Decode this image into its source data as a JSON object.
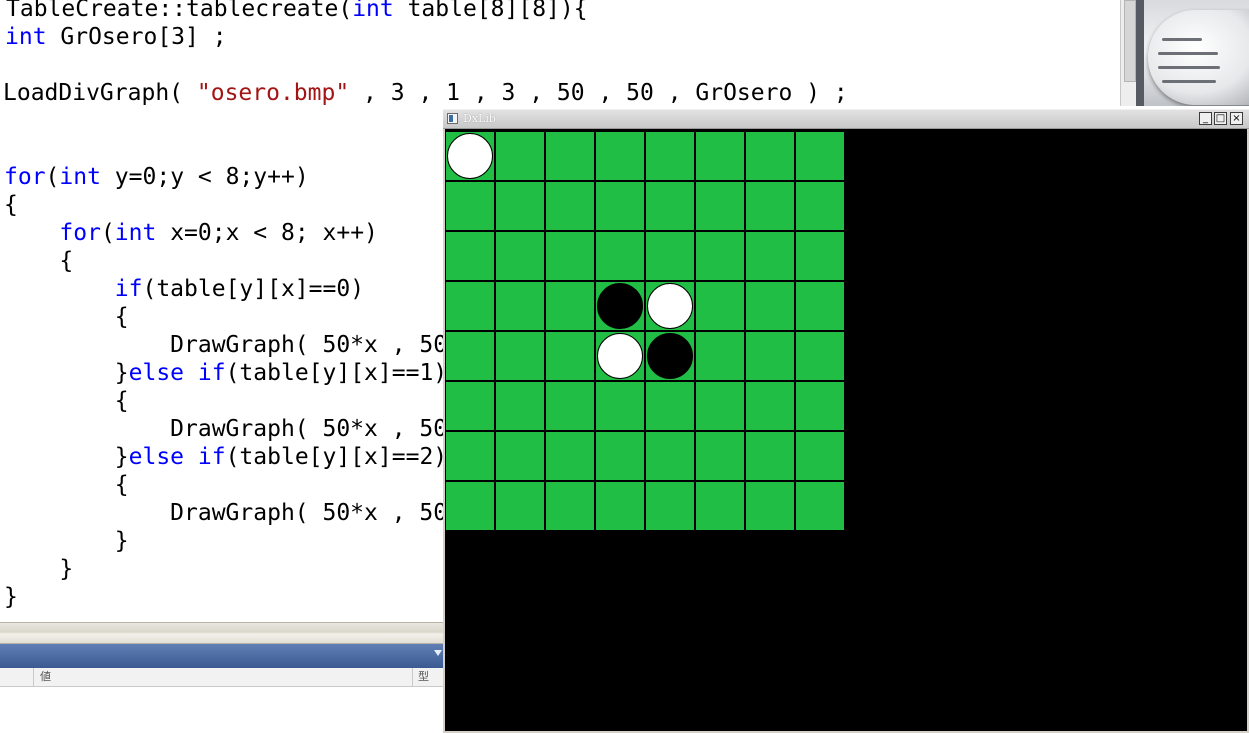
{
  "editor": {
    "lines": [
      [
        {
          "t": "TableCreate::tablecreate("
        },
        {
          "t": "int",
          "c": "kw"
        },
        {
          "t": " table[8][8]){"
        }
      ],
      [
        {
          "t": "int",
          "c": "kw"
        },
        {
          "t": " GrOsero[3] ;"
        }
      ],
      [],
      [
        {
          "t": "LoadDivGraph( "
        },
        {
          "t": "\"osero.bmp\"",
          "c": "str"
        },
        {
          "t": " , 3 , 1 , 3 , 50 , 50 , GrOsero ) ;"
        }
      ],
      [],
      [],
      [
        {
          "t": "for",
          "c": "kw"
        },
        {
          "t": "("
        },
        {
          "t": "int",
          "c": "kw"
        },
        {
          "t": " y=0;y < 8;y++)"
        }
      ],
      [
        {
          "t": "{"
        }
      ],
      [
        {
          "t": "    "
        },
        {
          "t": "for",
          "c": "kw"
        },
        {
          "t": "("
        },
        {
          "t": "int",
          "c": "kw"
        },
        {
          "t": " x=0;x < 8; x++)"
        }
      ],
      [
        {
          "t": "    {"
        }
      ],
      [
        {
          "t": "        "
        },
        {
          "t": "if",
          "c": "kw"
        },
        {
          "t": "(table[y][x]==0)"
        }
      ],
      [
        {
          "t": "        {"
        }
      ],
      [
        {
          "t": "            DrawGraph( 50*x , 50"
        }
      ],
      [
        {
          "t": "        }"
        },
        {
          "t": "else",
          "c": "kw"
        },
        {
          "t": " "
        },
        {
          "t": "if",
          "c": "kw"
        },
        {
          "t": "(table[y][x]==1)"
        }
      ],
      [
        {
          "t": "        {"
        }
      ],
      [
        {
          "t": "            DrawGraph( 50*x , 50"
        }
      ],
      [
        {
          "t": "        }"
        },
        {
          "t": "else",
          "c": "kw"
        },
        {
          "t": " "
        },
        {
          "t": "if",
          "c": "kw"
        },
        {
          "t": "(table[y][x]==2)"
        }
      ],
      [
        {
          "t": "        {"
        }
      ],
      [
        {
          "t": "            DrawGraph( 50*x , 50"
        }
      ],
      [
        {
          "t": "        }"
        }
      ],
      [
        {
          "t": "    }"
        }
      ],
      [
        {
          "t": "}"
        }
      ]
    ]
  },
  "bottom_panel": {
    "columns": [
      "値",
      "型"
    ]
  },
  "dxlib_window": {
    "title": "DxLib",
    "buttons": {
      "minimize": "_",
      "maximize": "□",
      "close": "×"
    },
    "board": [
      [
        2,
        0,
        0,
        0,
        0,
        0,
        0,
        0
      ],
      [
        0,
        0,
        0,
        0,
        0,
        0,
        0,
        0
      ],
      [
        0,
        0,
        0,
        0,
        0,
        0,
        0,
        0
      ],
      [
        0,
        0,
        0,
        1,
        2,
        0,
        0,
        0
      ],
      [
        0,
        0,
        0,
        2,
        1,
        0,
        0,
        0
      ],
      [
        0,
        0,
        0,
        0,
        0,
        0,
        0,
        0
      ],
      [
        0,
        0,
        0,
        0,
        0,
        0,
        0,
        0
      ],
      [
        0,
        0,
        0,
        0,
        0,
        0,
        0,
        0
      ]
    ],
    "colors": {
      "board": "#20be44",
      "black_stone": "#000000",
      "white_stone": "#ffffff",
      "background": "#000000"
    }
  }
}
